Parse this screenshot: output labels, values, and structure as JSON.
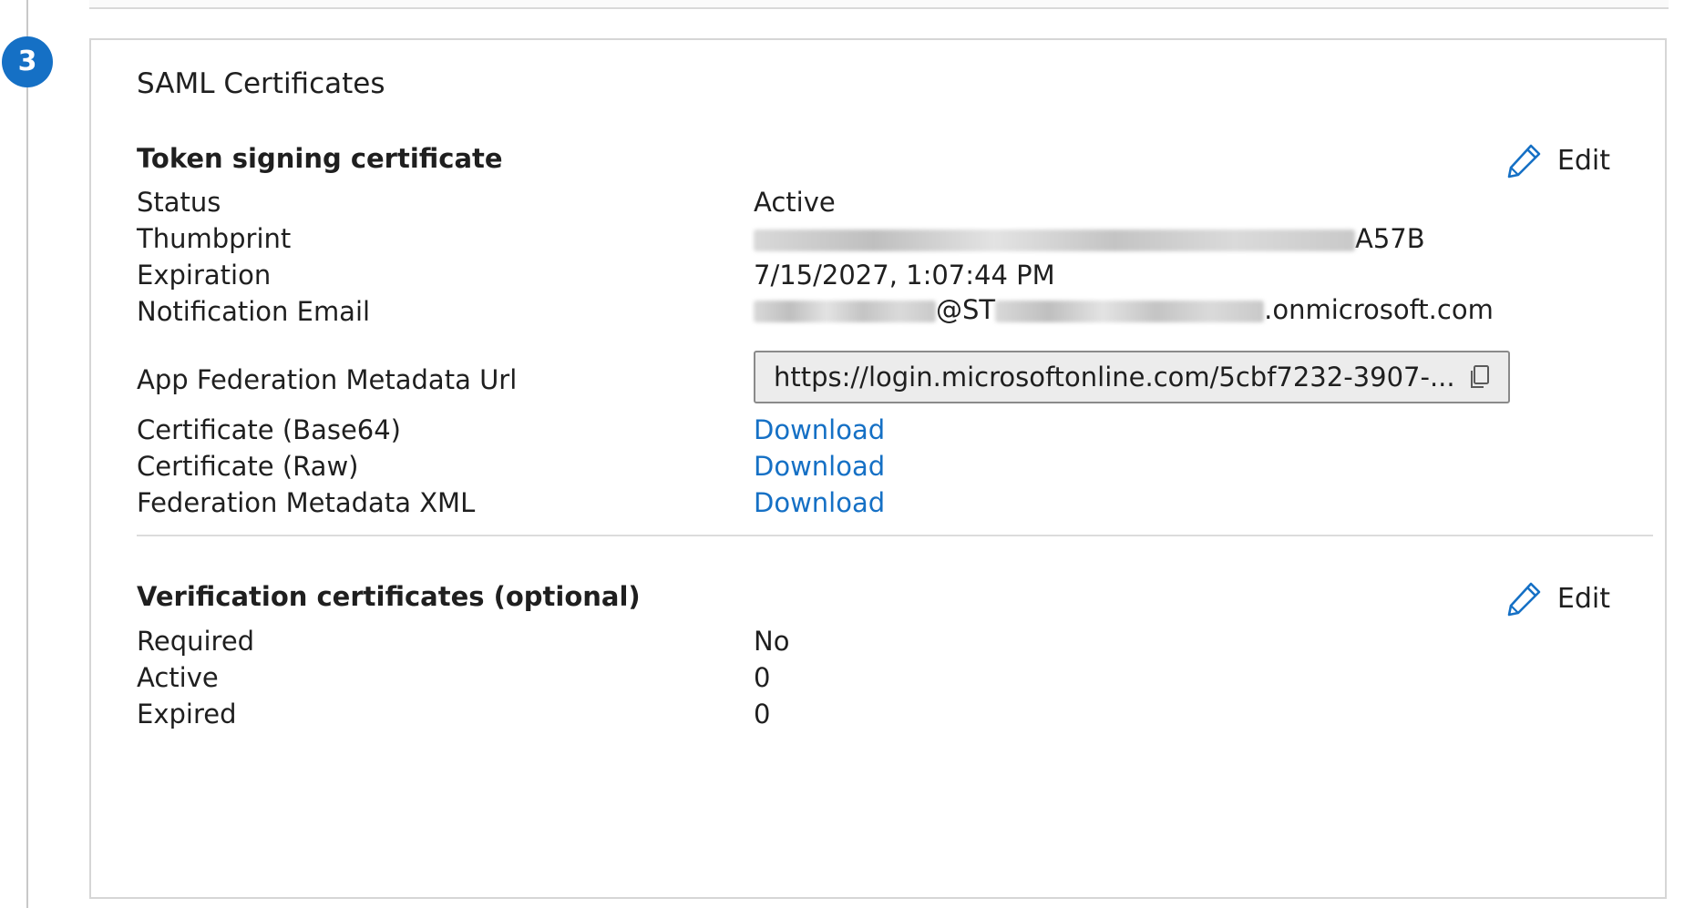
{
  "step": {
    "number": "3"
  },
  "card": {
    "title": "SAML Certificates"
  },
  "token_signing": {
    "title": "Token signing certificate",
    "edit_label": "Edit",
    "rows": {
      "status": {
        "label": "Status",
        "value": "Active"
      },
      "thumbprint": {
        "label": "Thumbprint",
        "value_visible_suffix": "A57B"
      },
      "expiration": {
        "label": "Expiration",
        "value": "7/15/2027, 1:07:44 PM"
      },
      "notification_email": {
        "label": "Notification Email",
        "value_part_1": "@ST",
        "value_part_2": ".onmicrosoft.com"
      },
      "app_federation_metadata_url": {
        "label": "App Federation Metadata Url",
        "value": "https://login.microsoftonline.com/5cbf7232-3907-..."
      },
      "certificate_base64": {
        "label": "Certificate (Base64)",
        "link": "Download"
      },
      "certificate_raw": {
        "label": "Certificate (Raw)",
        "link": "Download"
      },
      "federation_metadata_xml": {
        "label": "Federation Metadata XML",
        "link": "Download"
      }
    }
  },
  "verification": {
    "title": "Verification certificates (optional)",
    "edit_label": "Edit",
    "rows": {
      "required": {
        "label": "Required",
        "value": "No"
      },
      "active": {
        "label": "Active",
        "value": "0"
      },
      "expired": {
        "label": "Expired",
        "value": "0"
      }
    }
  },
  "icons": {
    "edit": "pencil-icon",
    "copy": "copy-icon"
  },
  "colors": {
    "accent": "#1570c5",
    "border": "#d6d6d6",
    "text": "#1f1f1f"
  }
}
